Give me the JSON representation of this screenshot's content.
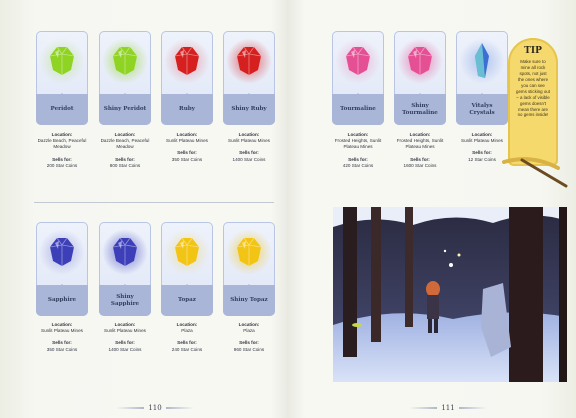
{
  "colors": {
    "ruby": "#d61f1f",
    "peridot": "#8fd323",
    "sapphire": "#3c3fb8",
    "topaz": "#f2c413",
    "tourmaline": "#e55095",
    "vitalys": "#3b6fd4",
    "card_label": "#a9b6d8"
  },
  "left_page": {
    "gems_top": [
      {
        "name": "Peridot",
        "gem": "peridot",
        "location_label": "Location:",
        "location": "Dazzle Beach, Peaceful Meadow",
        "sells_label": "Sells for:",
        "price": "200 Star Coins"
      },
      {
        "name": "Shiny Peridot",
        "gem": "peridot",
        "location_label": "Location:",
        "location": "Dazzle Beach, Peaceful Meadow",
        "sells_label": "Sells for:",
        "price": "800 Star Coins"
      },
      {
        "name": "Ruby",
        "gem": "ruby",
        "location_label": "Location:",
        "location": "Sunlit Plateau Mines",
        "sells_label": "Sells for:",
        "price": "350 Star Coins"
      },
      {
        "name": "Shiny Ruby",
        "gem": "ruby",
        "location_label": "Location:",
        "location": "Sunlit Plateau Mines",
        "sells_label": "Sells for:",
        "price": "1400 Star Coins"
      }
    ],
    "gems_bottom": [
      {
        "name": "Sapphire",
        "gem": "sapphire",
        "location_label": "Location:",
        "location": "Sunlit Plateau Mines",
        "sells_label": "Sells for:",
        "price": "350 Star Coins"
      },
      {
        "name": "Shiny Sapphire",
        "gem": "sapphire",
        "location_label": "Location:",
        "location": "Sunlit Plateau Mines",
        "sells_label": "Sells for:",
        "price": "1400 Star Coins"
      },
      {
        "name": "Topaz",
        "gem": "topaz",
        "location_label": "Location:",
        "location": "Plaza",
        "sells_label": "Sells for:",
        "price": "240 Star Coins"
      },
      {
        "name": "Shiny Topaz",
        "gem": "topaz",
        "location_label": "Location:",
        "location": "Plaza",
        "sells_label": "Sells for:",
        "price": "960 Star Coins"
      }
    ],
    "page_number": "110"
  },
  "right_page": {
    "gems": [
      {
        "name": "Tourmaline",
        "gem": "tourmaline",
        "location_label": "Location:",
        "location": "Frosted Heights, Sunlit Plateau Mines",
        "sells_label": "Sells for:",
        "price": "420 Star Coins"
      },
      {
        "name": "Shiny Tourmaline",
        "gem": "tourmaline",
        "location_label": "Location:",
        "location": "Frosted Heights, Sunlit Plateau Mines",
        "sells_label": "Sells for:",
        "price": "1600 Star Coins"
      },
      {
        "name": "Vitalys Crystals",
        "gem": "vitalys",
        "location_label": "Location:",
        "location": "Sunlit Plateau Mines",
        "sells_label": "Sells for:",
        "price": "12 Star Coins"
      }
    ],
    "tip": {
      "title": "TIP",
      "text": "Make sure to mine all rock spots, not just the ones where you can see gems sticking out – a lack of visible gems doesn't mean there are no gems inside!"
    },
    "page_number": "111"
  }
}
